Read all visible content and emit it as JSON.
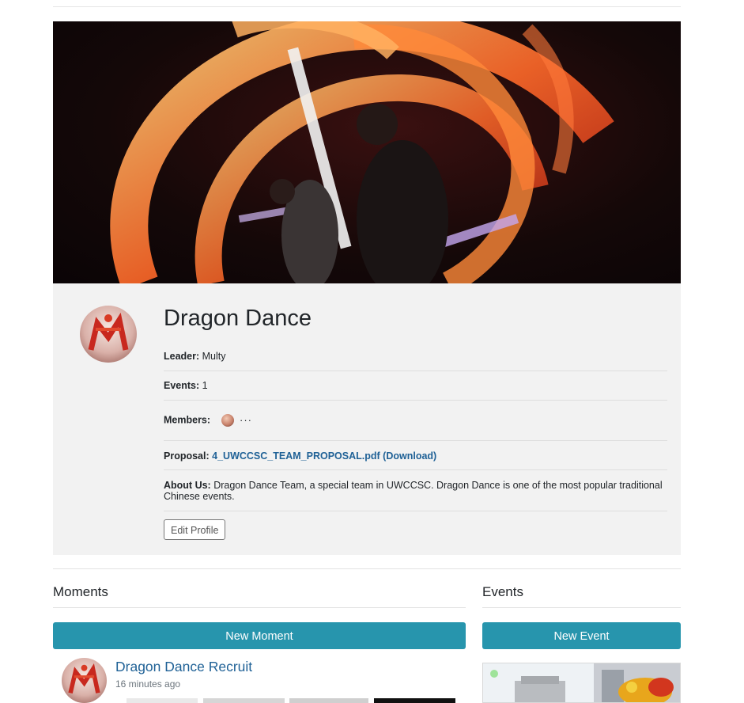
{
  "group": {
    "name": "Dragon Dance",
    "leader_label": "Leader:",
    "leader": "Multy",
    "events_label": "Events:",
    "events_count": "1",
    "members_label": "Members:",
    "members_more": "···",
    "proposal_label": "Proposal:",
    "proposal_file": "4_UWCCSC_TEAM_PROPOSAL.pdf",
    "proposal_download": "(Download)",
    "about_label": "About Us:",
    "about_text": "Dragon Dance Team, a special team in UWCCSC. Dragon Dance is one of the most popular traditional Chinese events.",
    "edit_button": "Edit Profile"
  },
  "moments": {
    "title": "Moments",
    "new_button": "New Moment",
    "items": [
      {
        "title": "Dragon Dance Recruit",
        "time": "16 minutes ago"
      }
    ]
  },
  "events": {
    "title": "Events",
    "new_button": "New Event"
  },
  "icons": {
    "group_avatar": "dragon-dance-avatar-icon",
    "member_avatar": "member-avatar-icon",
    "status": "online-status-icon"
  },
  "colors": {
    "accent": "#2795ad",
    "link": "#1f6196",
    "card_bg": "#f2f2f2",
    "status_green": "#9fe39a"
  }
}
